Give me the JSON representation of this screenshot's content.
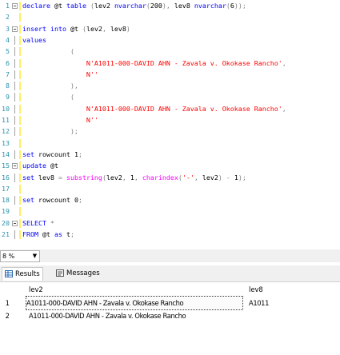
{
  "editor": {
    "lines": [
      {
        "n": "1",
        "tokens": [
          [
            "kw",
            "declare "
          ],
          [
            "",
            "@t "
          ],
          [
            "kw",
            "table "
          ],
          [
            "gr",
            "("
          ],
          [
            "",
            "lev2 "
          ],
          [
            "kw",
            "nvarchar"
          ],
          [
            "gr",
            "("
          ],
          [
            "",
            "200"
          ],
          [
            "gr",
            "), "
          ],
          [
            "",
            "lev8 "
          ],
          [
            "kw",
            "nvarchar"
          ],
          [
            "gr",
            "("
          ],
          [
            "",
            "6"
          ],
          [
            "gr",
            "));"
          ]
        ]
      },
      {
        "n": "2",
        "tokens": []
      },
      {
        "n": "3",
        "tokens": [
          [
            "kw",
            "insert into "
          ],
          [
            "",
            "@t "
          ],
          [
            "gr",
            "("
          ],
          [
            "",
            "lev2"
          ],
          [
            "gr",
            ", "
          ],
          [
            "",
            "lev8"
          ],
          [
            "gr",
            ")"
          ]
        ]
      },
      {
        "n": "4",
        "tokens": [
          [
            "kw",
            "values"
          ]
        ]
      },
      {
        "n": "5",
        "tokens": [
          [
            "gr",
            "            ("
          ]
        ]
      },
      {
        "n": "6",
        "tokens": [
          [
            "str",
            "                N'A1011-000-DAVID AHN - Zavala v. Okokase Rancho'"
          ],
          [
            "gr",
            ","
          ]
        ]
      },
      {
        "n": "7",
        "tokens": [
          [
            "str",
            "                N''"
          ]
        ]
      },
      {
        "n": "8",
        "tokens": [
          [
            "gr",
            "            ),"
          ]
        ]
      },
      {
        "n": "9",
        "tokens": [
          [
            "gr",
            "            ("
          ]
        ]
      },
      {
        "n": "10",
        "tokens": [
          [
            "str",
            "                N'A1011-000-DAVID AHN - Zavala v. Okokase Rancho'"
          ],
          [
            "gr",
            ","
          ]
        ]
      },
      {
        "n": "11",
        "tokens": [
          [
            "str",
            "                N''"
          ]
        ]
      },
      {
        "n": "12",
        "tokens": [
          [
            "gr",
            "            );"
          ]
        ]
      },
      {
        "n": "13",
        "tokens": []
      },
      {
        "n": "14",
        "tokens": [
          [
            "kw",
            "set "
          ],
          [
            "",
            "rowcount 1"
          ],
          [
            "gr",
            ";"
          ]
        ]
      },
      {
        "n": "15",
        "tokens": [
          [
            "kw",
            "update "
          ],
          [
            "",
            "@t"
          ]
        ]
      },
      {
        "n": "16",
        "tokens": [
          [
            "kw",
            "set "
          ],
          [
            "",
            "lev8 "
          ],
          [
            "gr",
            "= "
          ],
          [
            "fn",
            "substring"
          ],
          [
            "gr",
            "("
          ],
          [
            "",
            "lev2"
          ],
          [
            "gr",
            ", "
          ],
          [
            "",
            "1"
          ],
          [
            "gr",
            ", "
          ],
          [
            "fn",
            "charindex"
          ],
          [
            "gr",
            "("
          ],
          [
            "str",
            "'-'"
          ],
          [
            "gr",
            ", "
          ],
          [
            "",
            "lev2"
          ],
          [
            "gr",
            ") - "
          ],
          [
            "",
            "1"
          ],
          [
            "gr",
            ");"
          ]
        ]
      },
      {
        "n": "17",
        "tokens": []
      },
      {
        "n": "18",
        "tokens": [
          [
            "kw",
            "set "
          ],
          [
            "",
            "rowcount 0"
          ],
          [
            "gr",
            ";"
          ]
        ]
      },
      {
        "n": "19",
        "tokens": []
      },
      {
        "n": "20",
        "tokens": [
          [
            "kw",
            "SELECT "
          ],
          [
            "gr",
            "*"
          ]
        ]
      },
      {
        "n": "21",
        "tokens": [
          [
            "kw",
            "FROM "
          ],
          [
            "",
            "@t "
          ],
          [
            "kw",
            "as "
          ],
          [
            "",
            "t"
          ],
          [
            "gr",
            ";"
          ]
        ]
      }
    ]
  },
  "zoom": {
    "value": "8 %",
    "dropdown_icon": "chevron-down-icon"
  },
  "tabs": {
    "results": "Results",
    "messages": "Messages"
  },
  "grid": {
    "columns": [
      "lev2",
      "lev8"
    ],
    "rows": [
      {
        "num": "1",
        "lev2": "A1011-000-DAVID AHN - Zavala v. Okokase Rancho",
        "lev8": "A1011"
      },
      {
        "num": "2",
        "lev2": "A1011-000-DAVID AHN - Zavala v. Okokase Rancho",
        "lev8": ""
      }
    ]
  }
}
